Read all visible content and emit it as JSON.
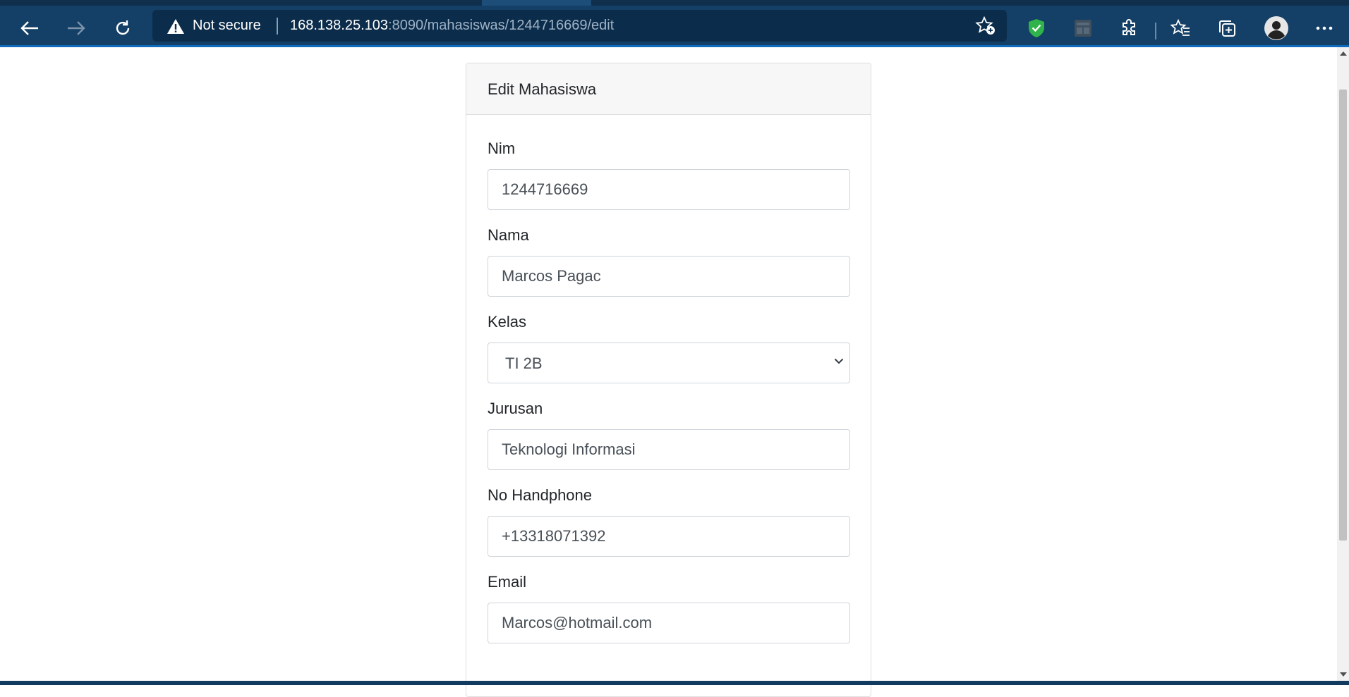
{
  "browser": {
    "security_label": "Not secure",
    "url_host": "168.138.25.103",
    "url_rest": ":8090/mahasiswas/1244716669/edit",
    "icons": [
      "back-icon",
      "forward-icon",
      "refresh-icon",
      "warning-icon",
      "add-favorite-icon",
      "shield-check-icon",
      "extension-app-icon",
      "extensions-puzzle-icon",
      "favorites-icon",
      "collections-icon",
      "profile-avatar-icon",
      "more-menu-icon"
    ],
    "colors": {
      "chrome": "#143f66",
      "omnibox": "#0b2c4a",
      "shield": "#2fb34a"
    }
  },
  "form": {
    "title": "Edit Mahasiswa",
    "fields": [
      {
        "label": "Nim",
        "value": "1244716669"
      },
      {
        "label": "Nama",
        "value": "Marcos Pagac"
      },
      {
        "label": "Kelas",
        "value": "TI 2B"
      },
      {
        "label": "Jurusan",
        "value": "Teknologi Informasi"
      },
      {
        "label": "No Handphone",
        "value": "+13318071392"
      },
      {
        "label": "Email",
        "value": "Marcos@hotmail.com"
      }
    ]
  }
}
